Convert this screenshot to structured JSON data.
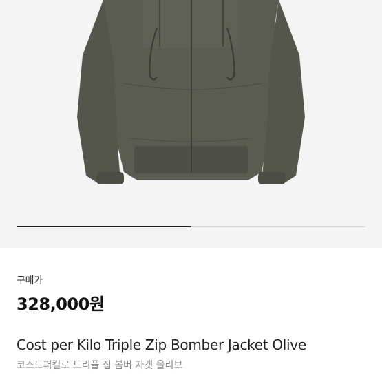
{
  "product": {
    "image_alt_icon": "jacket-image",
    "carousel_progress": 0.5,
    "price_label": "구매가",
    "price": "328,000원",
    "name": "Cost per Kilo Triple Zip Bomber Jacket Olive",
    "name_korean": "코스트퍼킬로 트리플 집 봄버 자켓 올리브"
  },
  "colors": {
    "jacket": "#57594f",
    "background": "#f4f4f4"
  }
}
